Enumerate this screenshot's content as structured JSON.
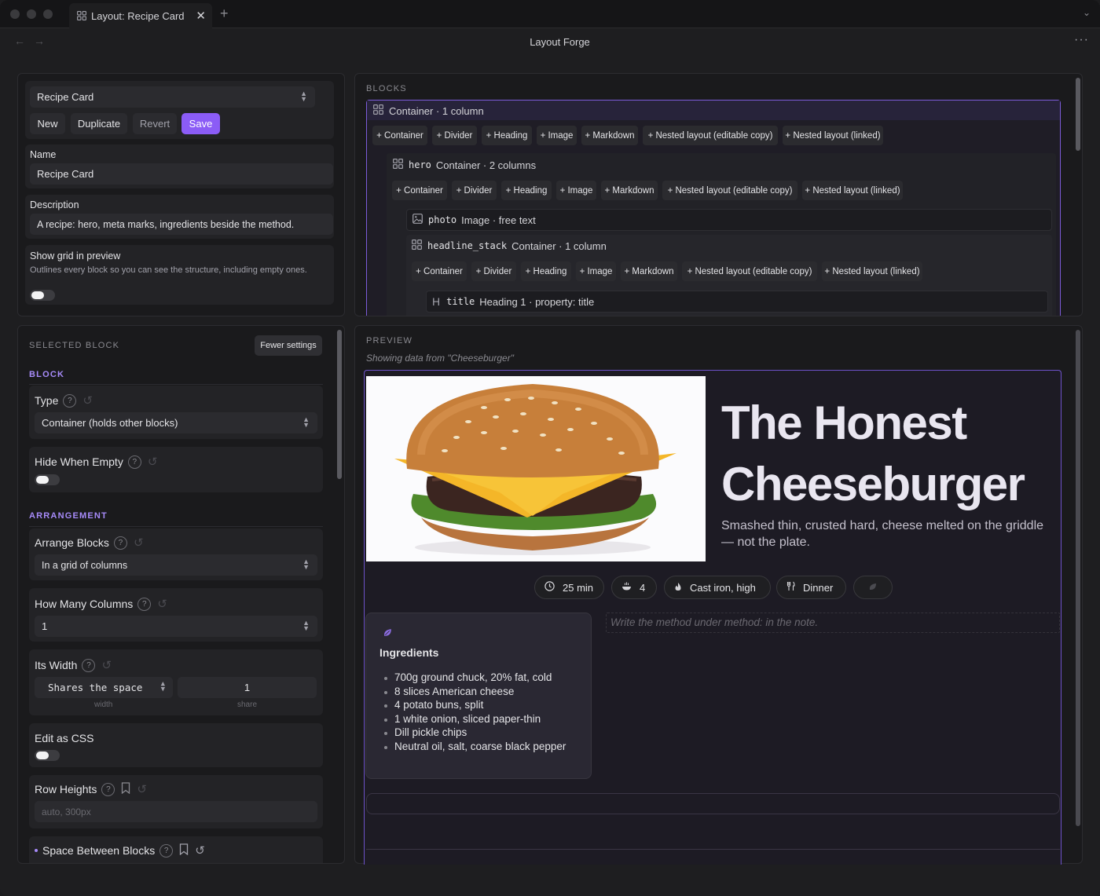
{
  "window": {
    "tab_title": "Layout: Recipe Card",
    "app_title": "Layout Forge"
  },
  "layout_panel": {
    "selected_layout": "Recipe Card",
    "buttons": {
      "new": "New",
      "duplicate": "Duplicate",
      "revert": "Revert",
      "save": "Save"
    },
    "name_label": "Name",
    "name_value": "Recipe Card",
    "description_label": "Description",
    "description_value": "A recipe: hero, meta marks, ingredients beside the method.",
    "show_grid_label": "Show grid in preview",
    "show_grid_help": "Outlines every block so you can see the structure, including empty ones.",
    "show_grid_on": false
  },
  "blocks_panel": {
    "header": "BLOCKS",
    "add_buttons": [
      "+ Container",
      "+ Divider",
      "+ Heading",
      "+ Image",
      "+ Markdown",
      "+ Nested layout (editable copy)",
      "+ Nested layout (linked)"
    ],
    "tree": {
      "root": {
        "name": "",
        "type": "Container · 1 column"
      },
      "hero": {
        "name": "hero",
        "type": "Container · 2 columns"
      },
      "photo": {
        "name": "photo",
        "type": "Image · free text"
      },
      "headline_stack": {
        "name": "headline_stack",
        "type": "Container · 1 column"
      },
      "title": {
        "name": "title",
        "type": "Heading 1 · property: title"
      }
    }
  },
  "selected_block": {
    "header": "SELECTED BLOCK",
    "fewer_settings": "Fewer settings",
    "block_section": "BLOCK",
    "type_label": "Type",
    "type_value": "Container (holds other blocks)",
    "hide_when_empty_label": "Hide When Empty",
    "arrangement_section": "ARRANGEMENT",
    "arrange_blocks_label": "Arrange Blocks",
    "arrange_blocks_value": "In a grid of columns",
    "how_many_columns_label": "How Many Columns",
    "how_many_columns_value": "1",
    "its_width_label": "Its Width",
    "its_width_mode": "Shares the space",
    "its_width_value": "1",
    "width_caption": "width",
    "share_caption": "share",
    "edit_as_css_label": "Edit as CSS",
    "row_heights_label": "Row Heights",
    "row_heights_placeholder": "auto, 300px",
    "space_between_label": "Space Between Blocks"
  },
  "preview": {
    "header": "PREVIEW",
    "source_note": "Showing data from \"Cheeseburger\"",
    "title_line1": "The Honest",
    "title_line2": "Cheeseburger",
    "subtitle": "Smashed thin, crusted hard, cheese melted on the griddle — not the plate.",
    "chips": [
      {
        "icon": "clock-icon",
        "text": "25 min"
      },
      {
        "icon": "bowl-icon",
        "text": "4"
      },
      {
        "icon": "flame-icon",
        "text": "Cast iron, high"
      },
      {
        "icon": "utensils-icon",
        "text": "Dinner"
      },
      {
        "icon": "leaf-icon",
        "text": ""
      }
    ],
    "ingredients_title": "Ingredients",
    "ingredients": [
      "700g ground chuck, 20% fat, cold",
      "8 slices American cheese",
      "4 potato buns, split",
      "1 white onion, sliced paper-thin",
      "Dill pickle chips",
      "Neutral oil, salt, coarse black pepper"
    ],
    "method_placeholder": "Write the method under method: in the note."
  },
  "colors": {
    "accent": "#8b5cf6",
    "panel_bg": "#1a1a1c",
    "preview_bg": "#1d1b24"
  }
}
